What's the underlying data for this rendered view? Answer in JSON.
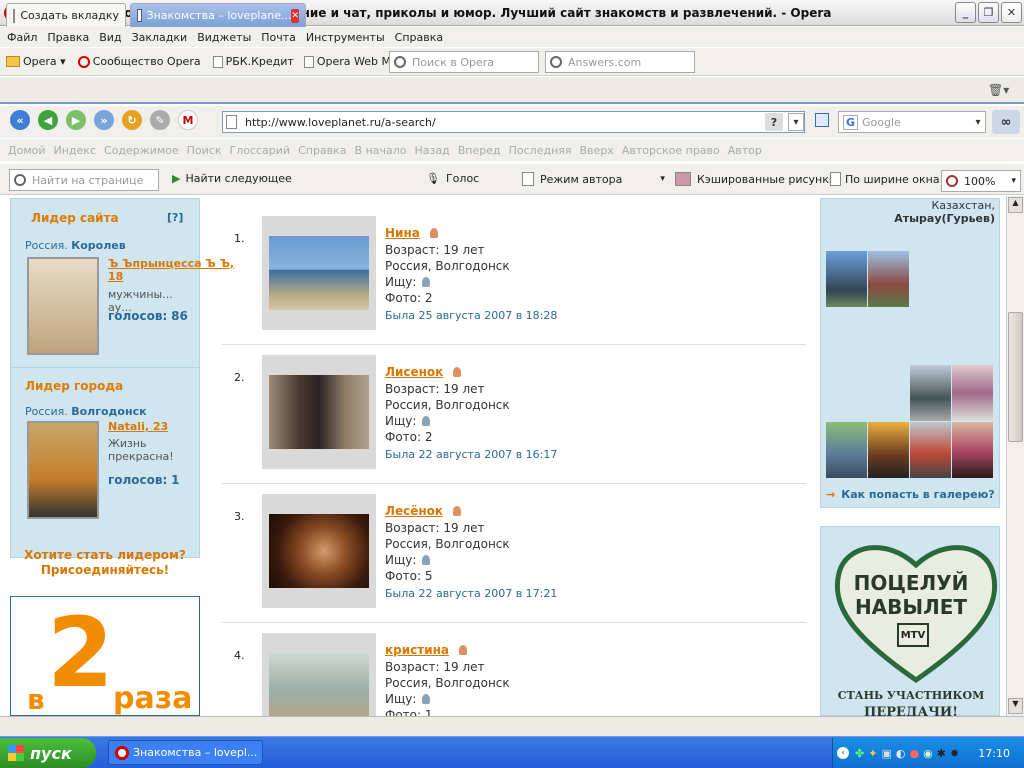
{
  "window": {
    "title": "Знакомства - loveplanet.ru. Фото, общение и чат, приколы и юмор. Лучший сайт знакомств и развлечений. - Opera"
  },
  "menu": [
    "Файл",
    "Правка",
    "Вид",
    "Закладки",
    "Виджеты",
    "Почта",
    "Инструменты",
    "Справка"
  ],
  "bookmarks": {
    "items": [
      "Opera",
      "Сообщество Opera",
      "РБК.Кредит",
      "Opera Web Mail"
    ],
    "search1_placeholder": "Поиск в Opera",
    "search2_placeholder": "Answers.com"
  },
  "tabs": {
    "new_tab": "Создать вкладку",
    "active_tab": "Знакомства – loveplane..."
  },
  "nav": {
    "url": "http://www.loveplanet.ru/a-search/",
    "search_engine": "Google"
  },
  "linkbar": [
    "Домой",
    "Индекс",
    "Содержимое",
    "Поиск",
    "Глоссарий",
    "Справка",
    "В начало",
    "Назад",
    "Вперед",
    "Последняя",
    "Вверх",
    "Авторское право",
    "Автор"
  ],
  "findbar": {
    "placeholder": "Найти на странице",
    "find_next": "Найти следующее",
    "voice": "Голос",
    "author_mode": "Режим автора",
    "cached_images": "Кэшированные рисунки",
    "fit_width": "По ширине окна",
    "zoom": "100%"
  },
  "left": {
    "site_leader_title": "Лидер сайта",
    "help": "[?]",
    "leader1": {
      "country": "Россия.",
      "city": "Королев",
      "name": "Ъ Ъпрынцесса Ъ Ъ, 18",
      "desc": "мужчины... ау...",
      "votes_label": "голосов:",
      "votes": "86"
    },
    "city_leader_title": "Лидер города",
    "leader2": {
      "country": "Россия.",
      "city": "Волгодонск",
      "name": "Natali, 23",
      "desc": "Жизнь прекрасна!",
      "votes_label": "голосов:",
      "votes": "1"
    },
    "cta_line1": "Хотите стать лидером?",
    "cta_line2": "Присоединяйтесь!",
    "ad_big": "2",
    "ad_prefix": "в",
    "ad_suffix": "раза"
  },
  "results": [
    {
      "num": "1.",
      "name": "Нина",
      "age": "Возраст: 19 лет",
      "location": "Россия, Волгодонск",
      "seek": "Ищу:",
      "photos": "Фото: 2",
      "seen": "Была 25 августа 2007 в 18:28"
    },
    {
      "num": "2.",
      "name": "Лисенок",
      "age": "Возраст: 19 лет",
      "location": "Россия, Волгодонск",
      "seek": "Ищу:",
      "photos": "Фото: 2",
      "seen": "Была 22 августа 2007 в 16:17"
    },
    {
      "num": "3.",
      "name": "Лесёнок",
      "age": "Возраст: 19 лет",
      "location": "Россия, Волгодонск",
      "seek": "Ищу:",
      "photos": "Фото: 5",
      "seen": "Была 22 августа 2007 в 17:21"
    },
    {
      "num": "4.",
      "name": "кристина",
      "age": "Возраст: 19 лет",
      "location": "Россия, Волгодонск",
      "seek": "Ищу:",
      "photos": "Фото: 1",
      "seen": ""
    }
  ],
  "right": {
    "loc_line1": "Казахстан,",
    "loc_line2": "Атырау(Гурьев)",
    "gallery_link": "Как попасть в галерею?",
    "ad_heart_line1": "ПОЦЕЛУЙ",
    "ad_heart_line2": "НАВЫЛЕТ",
    "ad_logo": "MTV",
    "ad_caption1": "СТАНЬ УЧАСТНИКОМ",
    "ad_caption2": "ПЕРЕДАЧИ!"
  },
  "taskbar": {
    "start": "пуск",
    "item": "Знакомства – lovepl...",
    "clock": "17:10"
  }
}
